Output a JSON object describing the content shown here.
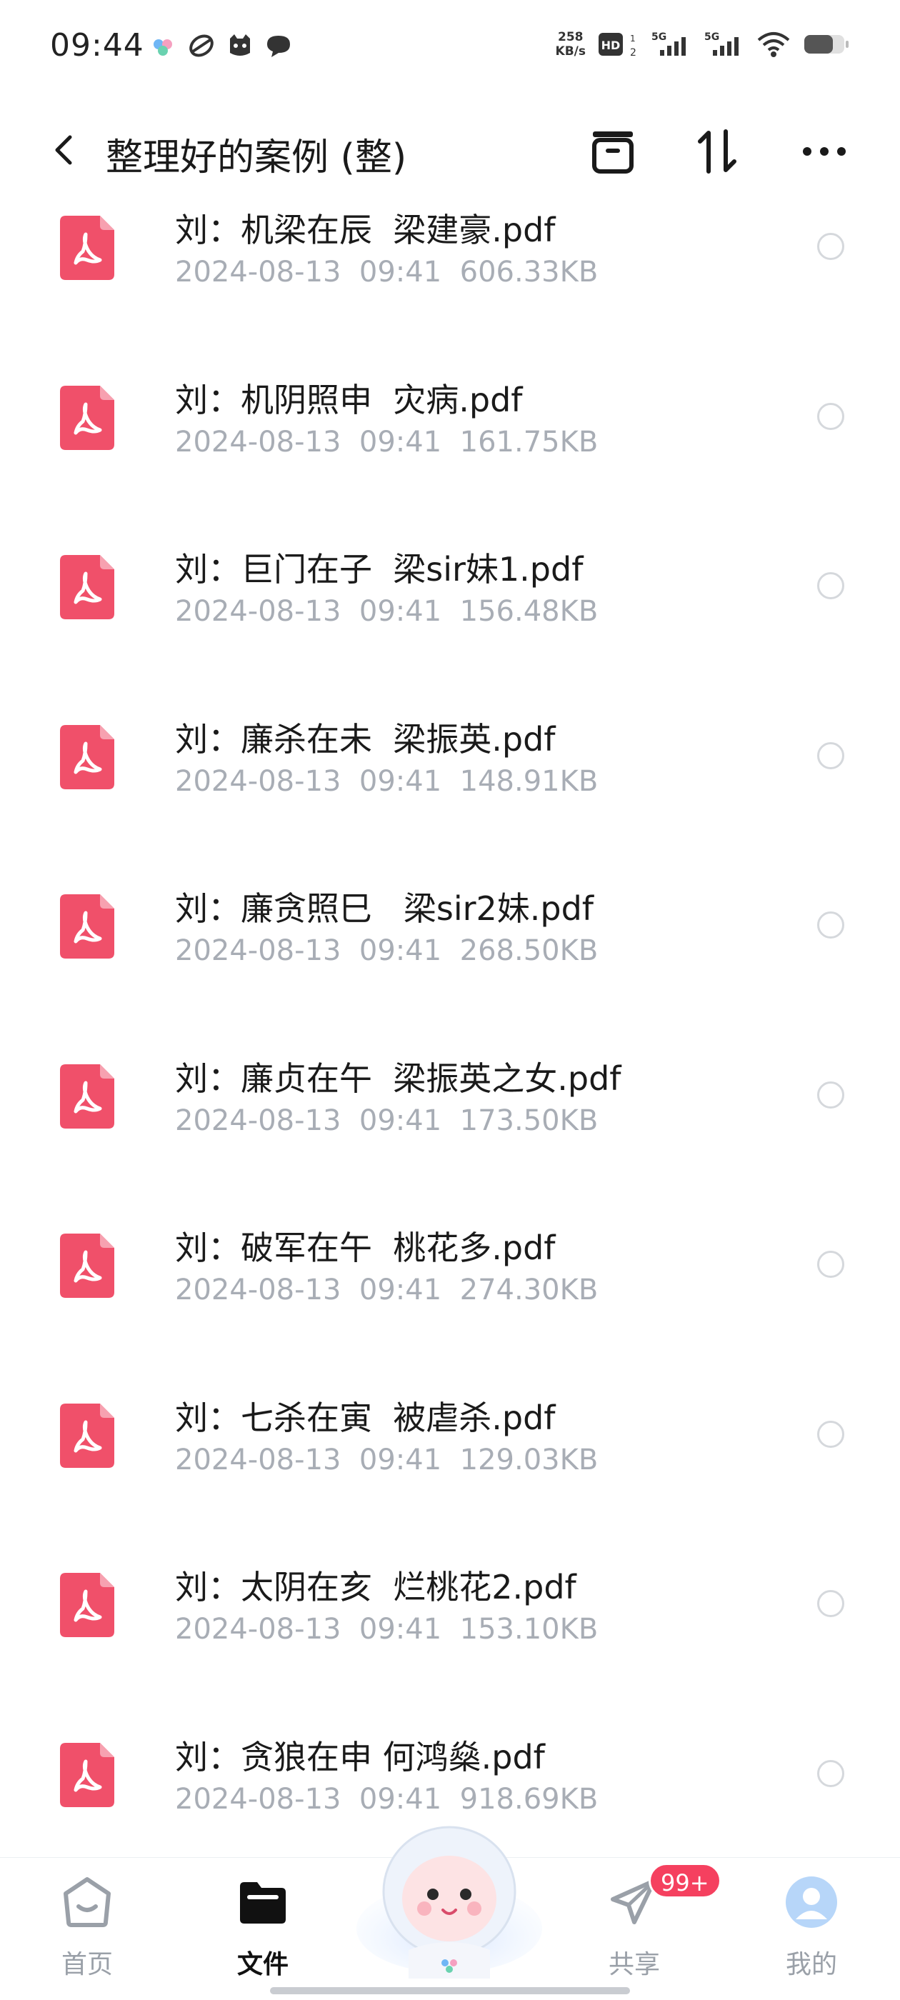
{
  "status_bar": {
    "time": "09:44",
    "speed_value": "258",
    "speed_unit": "KB/s",
    "hd_label": "HD",
    "network_1": "5G",
    "network_2": "5G",
    "icons": [
      "app-cloud-icon",
      "app-swirl-icon",
      "app-cat-icon",
      "chat-bubble-icon",
      "hd-voice-icon",
      "signal-icon",
      "wifi-icon",
      "battery-icon"
    ]
  },
  "header": {
    "title": "整理好的案例 (整)",
    "back_icon": "chevron-left-icon",
    "actions": [
      "archive-icon",
      "sort-icon",
      "more-icon"
    ]
  },
  "files": [
    {
      "name": "刘：机梁在辰  梁建豪.pdf",
      "date": "2024-08-13",
      "time": "09:41",
      "size": "606.33KB"
    },
    {
      "name": "刘：机阴照申  灾病.pdf",
      "date": "2024-08-13",
      "time": "09:41",
      "size": "161.75KB"
    },
    {
      "name": "刘：巨门在子  梁sir妹1.pdf",
      "date": "2024-08-13",
      "time": "09:41",
      "size": "156.48KB"
    },
    {
      "name": "刘：廉杀在未  梁振英.pdf",
      "date": "2024-08-13",
      "time": "09:41",
      "size": "148.91KB"
    },
    {
      "name": "刘：廉贪照巳   梁sir2妹.pdf",
      "date": "2024-08-13",
      "time": "09:41",
      "size": "268.50KB"
    },
    {
      "name": "刘：廉贞在午  梁振英之女.pdf",
      "date": "2024-08-13",
      "time": "09:41",
      "size": "173.50KB"
    },
    {
      "name": "刘：破军在午  桃花多.pdf",
      "date": "2024-08-13",
      "time": "09:41",
      "size": "274.30KB"
    },
    {
      "name": "刘：七杀在寅  被虐杀.pdf",
      "date": "2024-08-13",
      "time": "09:41",
      "size": "129.03KB"
    },
    {
      "name": "刘：太阴在亥  烂桃花2.pdf",
      "date": "2024-08-13",
      "time": "09:41",
      "size": "153.10KB"
    },
    {
      "name": "刘：贪狼在申 何鸿燊.pdf",
      "date": "2024-08-13",
      "time": "09:41",
      "size": "918.69KB"
    }
  ],
  "bottom_nav": {
    "home": "首页",
    "files": "文件",
    "share": "共享",
    "mine": "我的",
    "badge": "99+",
    "active": "files"
  },
  "colors": {
    "pdf_red": "#f0506a",
    "meta_gray": "#a8adb5",
    "badge_red": "#f5405f"
  }
}
